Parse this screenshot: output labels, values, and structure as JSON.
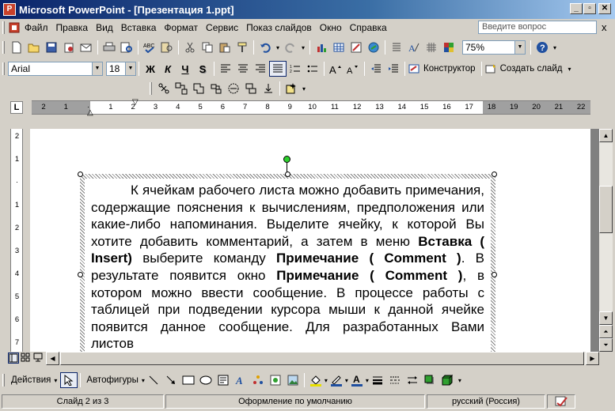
{
  "window": {
    "app_icon": "P",
    "title": "Microsoft PowerPoint - [Презентация 1.ppt]",
    "minimize": "_",
    "restore": "▫",
    "close": "✕"
  },
  "menu": {
    "items": [
      "Файл",
      "Правка",
      "Вид",
      "Вставка",
      "Формат",
      "Сервис",
      "Показ слайдов",
      "Окно",
      "Справка"
    ],
    "ask_placeholder": "Введите вопрос",
    "close": "x"
  },
  "standard_toolbar": {
    "zoom": "75%",
    "help_glyph": "?"
  },
  "format_toolbar": {
    "font": "Arial",
    "size": "18",
    "bold": "Ж",
    "italic": "К",
    "underline": "Ч",
    "shadow": "S",
    "designer_label": "Конструктор",
    "new_slide_label": "Создать слайд"
  },
  "ruler": {
    "h_numbers": [
      "2",
      "1",
      "",
      "1",
      "2",
      "3",
      "4",
      "5",
      "6",
      "7",
      "8",
      "9",
      "10",
      "11",
      "12",
      "13",
      "14",
      "15",
      "16",
      "17",
      "18",
      "19",
      "20",
      "21",
      "22"
    ],
    "v_numbers": [
      "2",
      "1",
      "",
      "1",
      "2",
      "3",
      "4",
      "5",
      "6",
      "7"
    ]
  },
  "slide": {
    "paragraph": [
      {
        "t": "К ячейкам рабочего листа можно добавить примечания, содержащие пояснения к вычислениям, предположения или какие-либо напоминания. Выделите ячейку, к которой Вы хотите добавить комментарий, а затем в меню ",
        "b": false
      },
      {
        "t": "Вставка ( Insert)",
        "b": true
      },
      {
        "t": " выберите команду ",
        "b": false
      },
      {
        "t": "Примечание ( Comment )",
        "b": true
      },
      {
        "t": ". В результате появится окно ",
        "b": false
      },
      {
        "t": "Примечание ( Comment )",
        "b": true
      },
      {
        "t": ", в котором можно ввести сообщение. В процессе работы с таблицей при подведении курсора мыши к данной ячейке появится данное сообщение. Для разработанных Вами листов",
        "b": false
      }
    ]
  },
  "drawing_toolbar": {
    "actions_label": "Действия",
    "autoshapes_label": "Автофигуры"
  },
  "status": {
    "slide": "Слайд 2 из 3",
    "design": "Оформление по умолчанию",
    "language": "русский (Россия)"
  }
}
